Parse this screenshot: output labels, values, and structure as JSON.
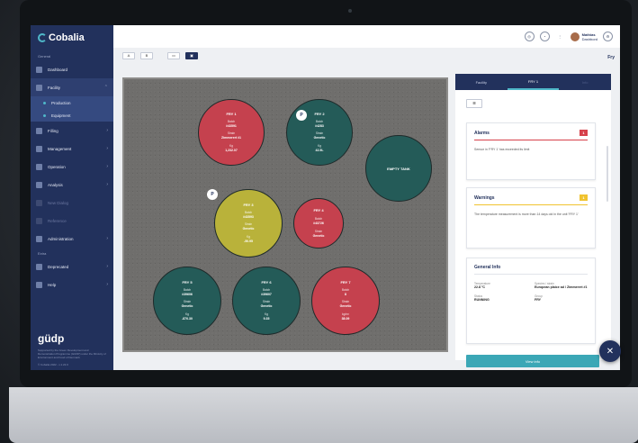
{
  "app": {
    "name": "Cobalia"
  },
  "sidebar": {
    "section_general": "General",
    "items": [
      {
        "label": "Dashboard"
      },
      {
        "label": "Facility"
      },
      {
        "label": "Production"
      },
      {
        "label": "Equipment"
      },
      {
        "label": "Filling"
      },
      {
        "label": "Management"
      },
      {
        "label": "Operation"
      },
      {
        "label": "Analysis"
      },
      {
        "label": "New Dialog"
      },
      {
        "label": "Reference"
      },
      {
        "label": "Administration"
      }
    ],
    "section_extra": "Extra",
    "extra_items": [
      {
        "label": "Deprecated"
      },
      {
        "label": "Help"
      }
    ],
    "brand": "güdp",
    "funding": "Supported by the Green Development and Demonstration Programme (GUDP) under the Ministry of Environment and Food of Denmark",
    "version": "© Cobalia 2022 - v.1.22.0"
  },
  "topbar": {
    "user_name": "Mathias",
    "user_role": "Dashbord"
  },
  "toolbar": {
    "b1": "A",
    "b2": "B",
    "b3": "▭",
    "b4": "▣",
    "right_label": "Fry"
  },
  "fryers": [
    {
      "id": "f1",
      "title": "FRY 1",
      "k1": "Batch",
      "v1": "#43591",
      "k2": "Strain",
      "v2": "Zimmerert #1",
      "k3": "Kg",
      "v3": "1,232.07",
      "color": "red"
    },
    {
      "id": "f2",
      "title": "FRY 2",
      "k1": "Batch",
      "v1": "#4283",
      "k2": "Strain",
      "v2": "Genetic",
      "k3": "Kg",
      "v3": "42.5L",
      "color": "teal"
    },
    {
      "id": "f3",
      "title": "EMPTY TANK",
      "color": "teal"
    },
    {
      "id": "f4",
      "title": "FRY 3",
      "k1": "Batch",
      "v1": "#43593",
      "k2": "Strain",
      "v2": "Genetic",
      "k3": "Kg",
      "v3": "-50.95",
      "color": "yellow"
    },
    {
      "id": "f5",
      "title": "FRY 4",
      "k1": "Batch",
      "v1": "#43726",
      "k2": "Strain",
      "v2": "Genetic",
      "color": "red"
    },
    {
      "id": "f6",
      "title": "FRY 5",
      "k1": "Batch",
      "v1": "#39606",
      "k2": "Strain",
      "v2": "Genetic",
      "k3": "Kg",
      "v3": "-870.30",
      "color": "teal"
    },
    {
      "id": "f7",
      "title": "FRY 6",
      "k1": "Batch",
      "v1": "#39607",
      "k2": "Strain",
      "v2": "Genetic",
      "k3": "Kg",
      "v3": "9.35",
      "color": "teal"
    },
    {
      "id": "f8",
      "title": "FRY 7",
      "k1": "Batch",
      "v1": "8",
      "k2": "Strain",
      "v2": "Genetic",
      "k3": "kg/m²",
      "v3": "38.09",
      "color": "red"
    }
  ],
  "pins": [
    "P",
    "P"
  ],
  "panel": {
    "tabs": [
      "Facility",
      "FRY 1",
      "Info"
    ],
    "filter_btn": "☰",
    "alarms": {
      "title": "Alarms",
      "count": "1",
      "text": "Sensor in 'FRY 1' has exceeded its limit",
      "color": "#d6414b"
    },
    "warnings": {
      "title": "Warnings",
      "count": "1",
      "text": "The temperature measurement is more than 14 days old in the unit 'FRY 1'",
      "color": "#f0c330"
    },
    "general": {
      "title": "General Info",
      "rows": [
        {
          "k": "Temperature",
          "v": "22.8 °C"
        },
        {
          "k": "Species / strain",
          "v": "European plaice ad / Zimmerert #1"
        },
        {
          "k": "Status",
          "v": "RUNNING"
        },
        {
          "k": "Group",
          "v": "FRY"
        }
      ]
    },
    "view_info": "View info"
  },
  "fab": "✕"
}
